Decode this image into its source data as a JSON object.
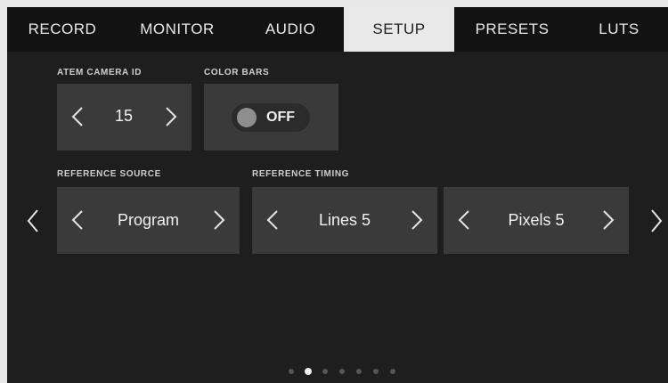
{
  "tabs": [
    {
      "label": "RECORD",
      "active": false
    },
    {
      "label": "MONITOR",
      "active": false
    },
    {
      "label": "AUDIO",
      "active": false
    },
    {
      "label": "SETUP",
      "active": true
    },
    {
      "label": "PRESETS",
      "active": false
    },
    {
      "label": "LUTS",
      "active": false
    }
  ],
  "atem_camera_id": {
    "label": "ATEM CAMERA ID",
    "value": "15"
  },
  "color_bars": {
    "label": "COLOR BARS",
    "value": "OFF",
    "enabled": false
  },
  "reference_source": {
    "label": "REFERENCE SOURCE",
    "value": "Program"
  },
  "reference_timing": {
    "label": "REFERENCE TIMING",
    "lines_value": "Lines 5",
    "pixels_value": "Pixels 5"
  },
  "pagination": {
    "total": 7,
    "current": 2
  },
  "colors": {
    "background": "#1e1e1e",
    "tabbar": "#121212",
    "active_tab": "#e9e9e9",
    "control_box": "#3a3a3a",
    "text": "#f2f2f2"
  }
}
